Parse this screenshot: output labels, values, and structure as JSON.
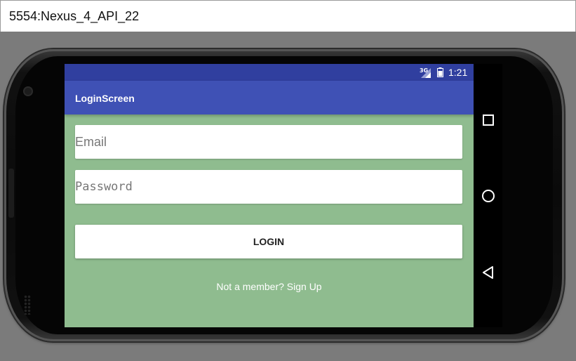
{
  "window": {
    "title": "5554:Nexus_4_API_22"
  },
  "status_bar": {
    "network": "3G",
    "time": "1:21"
  },
  "app_bar": {
    "title": "LoginScreen"
  },
  "form": {
    "email_placeholder": "Email",
    "email_value": "",
    "password_placeholder": "Password",
    "password_value": "",
    "login_label": "LOGIN",
    "signup_text": "Not a member? Sign Up"
  },
  "nav_bar": {
    "icons": [
      "recent-apps-icon",
      "home-icon",
      "back-icon"
    ]
  },
  "colors": {
    "status_bar": "#303f9f",
    "app_bar": "#3f51b5",
    "screen_background": "#8fbc8f",
    "titlebar": "#ffffff",
    "emulator_background": "#7b7b7b"
  }
}
